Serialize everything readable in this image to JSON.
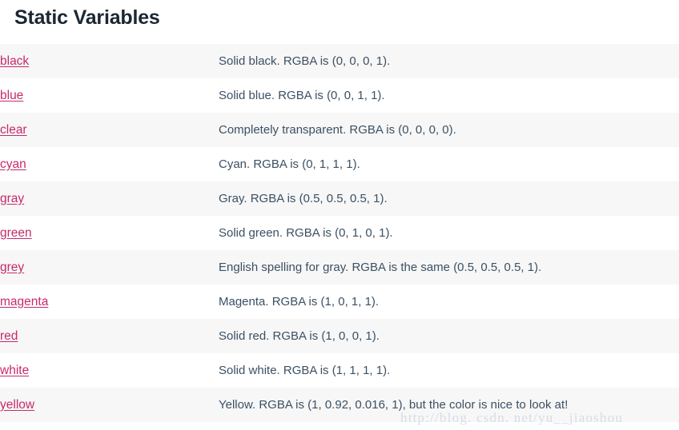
{
  "page": {
    "title": "Static Variables",
    "watermark": "http://blog. csdn. net/yu__jiaoshou"
  },
  "theme": {
    "link_color": "#c62a6b",
    "description_color": "#3c5063",
    "title_color": "#1b2733",
    "row_stripe_color": "#f7f7f7",
    "row_plain_color": "#ffffff"
  },
  "table": {
    "rows": [
      {
        "name": "black",
        "description": "Solid black. RGBA is (0, 0, 0, 1)."
      },
      {
        "name": "blue",
        "description": "Solid blue. RGBA is (0, 0, 1, 1)."
      },
      {
        "name": "clear",
        "description": "Completely transparent. RGBA is (0, 0, 0, 0)."
      },
      {
        "name": "cyan",
        "description": "Cyan. RGBA is (0, 1, 1, 1)."
      },
      {
        "name": "gray",
        "description": "Gray. RGBA is (0.5, 0.5, 0.5, 1)."
      },
      {
        "name": "green",
        "description": "Solid green. RGBA is (0, 1, 0, 1)."
      },
      {
        "name": "grey",
        "description": "English spelling for gray. RGBA is the same (0.5, 0.5, 0.5, 1)."
      },
      {
        "name": "magenta",
        "description": "Magenta. RGBA is (1, 0, 1, 1)."
      },
      {
        "name": "red",
        "description": "Solid red. RGBA is (1, 0, 0, 1)."
      },
      {
        "name": "white",
        "description": "Solid white. RGBA is (1, 1, 1, 1)."
      },
      {
        "name": "yellow",
        "description": "Yellow. RGBA is (1, 0.92, 0.016, 1), but the color is nice to look at!"
      }
    ]
  }
}
